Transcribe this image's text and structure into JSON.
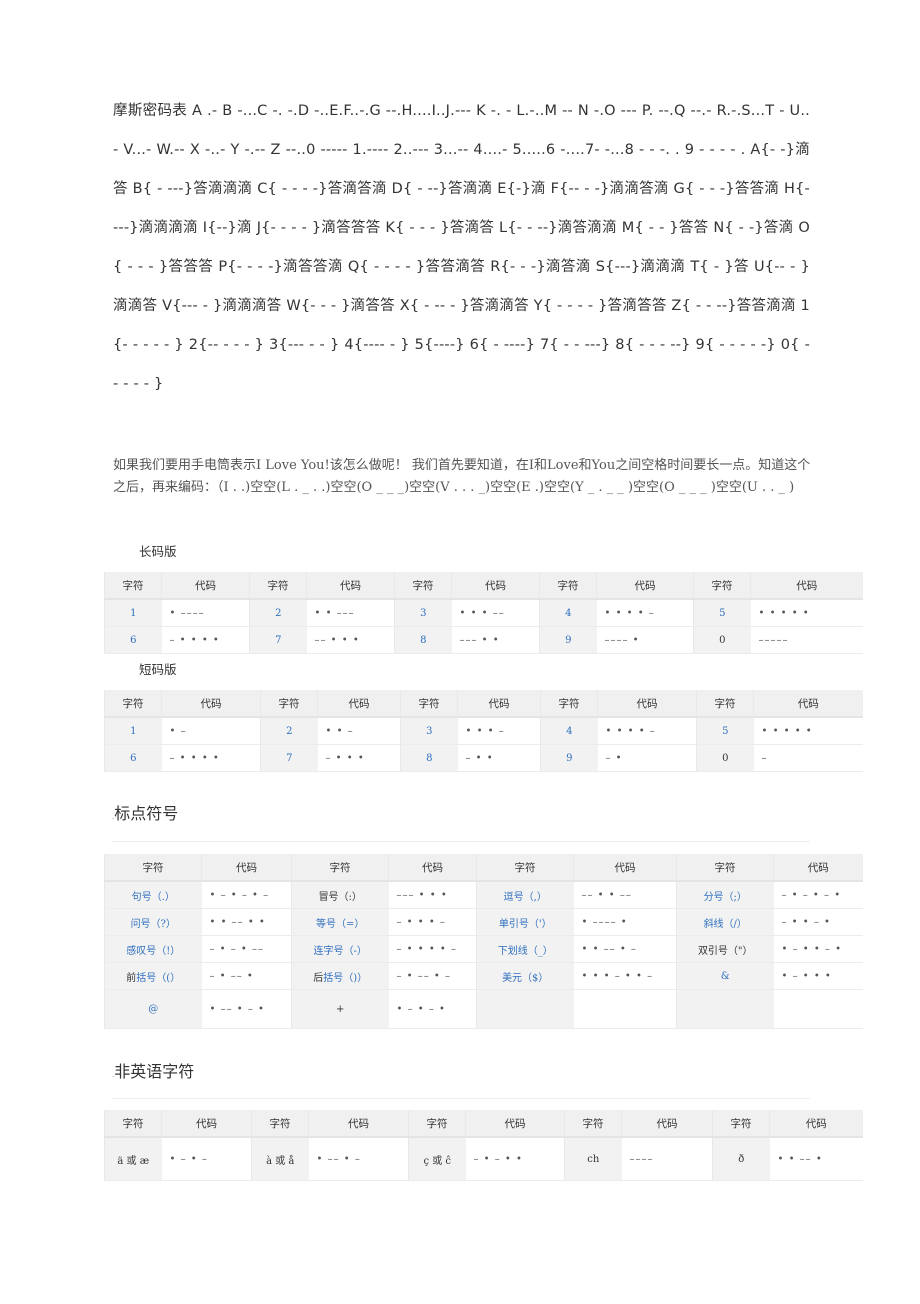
{
  "intro_text": "摩斯密码表 A .- B -...C -. -.D -..E.F..-.G --.H....I..J.--- K -. - L.-..M -- N -.O --- P. --.Q --.- R.-.S...T - U..- V...- W.-- X -..- Y -.-- Z --..0 ----- 1.---- 2..--- 3...-- 4....- 5.....6 -....7- -...8 - - -. . 9 - - - - . A{- -}滴答 B{ - ---}答滴滴滴 C{ - - - -}答滴答滴 D{ - --}答滴滴 E{-}滴 F{-- - -}滴滴答滴 G{ - - -}答答滴 H{----}滴滴滴滴 I{--}滴 J{- - - - }滴答答答 K{ - - - }答滴答 L{- - --}滴答滴滴 M{ - - }答答 N{ - -}答滴 O{ - - - }答答答 P{- - - -}滴答答滴 Q{ - - - - }答答滴答 R{- - -}滴答滴 S{---}滴滴滴 T{ - }答 U{-- - }滴滴答 V{--- - }滴滴滴答 W{- - - }滴答答 X{ - -- - }答滴滴答 Y{ - - - - }答滴答答 Z{ - - --}答答滴滴 1{- - - - - } 2{-- - - - } 3{--- - - } 4{---- - } 5{----} 6{ - ----} 7{ - - ---} 8{ - - - --} 9{ - - - - -} 0{ - - - - - }",
  "paragraph": "如果我们要用手电筒表示I Love You!该怎么做呢！  我们首先要知道，在I和Love和You之间空格时间要长一点。知道这个之后，再来编码：（I . .)空空(L . _ . .)空空(O _ _ _)空空(V . . . _)空空(E .)空空(Y _ . _ _ )空空(O _ _ _ )空空(U . . _ )",
  "long_version": {
    "title": "长码版",
    "headers": [
      "字符",
      "代码"
    ],
    "rows": [
      [
        {
          "ch": "1",
          "code": "• ––––"
        },
        {
          "ch": "2",
          "code": "• • –––"
        },
        {
          "ch": "3",
          "code": "• • • ––"
        },
        {
          "ch": "4",
          "code": "• • • • –"
        },
        {
          "ch": "5",
          "code": "• • • • •"
        }
      ],
      [
        {
          "ch": "6",
          "code": "– • • • •"
        },
        {
          "ch": "7",
          "code": "–– • • •"
        },
        {
          "ch": "8",
          "code": "––– • •"
        },
        {
          "ch": "9",
          "code": "–––– •"
        },
        {
          "ch": "0",
          "code": "–––––"
        }
      ]
    ]
  },
  "short_version": {
    "title": "短码版",
    "headers": [
      "字符",
      "代码"
    ],
    "rows": [
      [
        {
          "ch": "1",
          "code": "• –"
        },
        {
          "ch": "2",
          "code": "• • –"
        },
        {
          "ch": "3",
          "code": "• • • –"
        },
        {
          "ch": "4",
          "code": "• • • • –"
        },
        {
          "ch": "5",
          "code": "• • • • •"
        }
      ],
      [
        {
          "ch": "6",
          "code": "– • • • •"
        },
        {
          "ch": "7",
          "code": "– • • •"
        },
        {
          "ch": "8",
          "code": "– • •"
        },
        {
          "ch": "9",
          "code": "– •"
        },
        {
          "ch": "0",
          "code": "–"
        }
      ]
    ]
  },
  "punctuation": {
    "title": "标点符号",
    "headers": [
      "字符",
      "代码"
    ],
    "rows": [
      [
        {
          "ch": "句号（.）",
          "code": "• – • – • –"
        },
        {
          "ch": "冒号（:）",
          "code": "––– • • •"
        },
        {
          "ch": "逗号（,）",
          "code": "–– • • ––"
        },
        {
          "ch": "分号（;）",
          "code": "– • – • – •"
        }
      ],
      [
        {
          "ch": "问号（?）",
          "code": "• • –– • •"
        },
        {
          "ch": "等号（=）",
          "code": "– • • • –"
        },
        {
          "ch": "单引号（'）",
          "code": "• –––– •"
        },
        {
          "ch": "斜线（/）",
          "code": "– • • – •"
        }
      ],
      [
        {
          "ch": "感叹号（!）",
          "code": "– • – • ––"
        },
        {
          "ch": "连字号（-）",
          "code": "– • • • • –"
        },
        {
          "ch": "下划线（_）",
          "code": "• • –– • –"
        },
        {
          "ch": "双引号（\"）",
          "code": "• – • • – •"
        }
      ],
      [
        {
          "ch_prefix": "前",
          "ch": "括号（(）",
          "code": "– • –– •"
        },
        {
          "ch_prefix": "后",
          "ch": "括号（)）",
          "code": "– • –– • –"
        },
        {
          "ch": "美元（$）",
          "code": "• • • – • • –"
        },
        {
          "ch": "&",
          "code": "• – • • •"
        }
      ],
      [
        {
          "ch": "@",
          "code": "• –– • – •"
        },
        {
          "ch": "+",
          "code": "• – • – •"
        },
        {
          "ch": "",
          "code": ""
        },
        {
          "ch": "",
          "code": ""
        }
      ]
    ]
  },
  "non_english": {
    "title": "非英语字符",
    "headers": [
      "字符",
      "代码"
    ],
    "rows": [
      [
        {
          "ch": "ä 或 æ",
          "code": "• – • –"
        },
        {
          "ch": "à 或 å",
          "code": "• –– • –"
        },
        {
          "ch": "ç 或 ĉ",
          "code": "– • – • •"
        },
        {
          "ch": "ch",
          "code": "––––"
        },
        {
          "ch": "ð",
          "code": "• • –– •"
        }
      ]
    ]
  }
}
